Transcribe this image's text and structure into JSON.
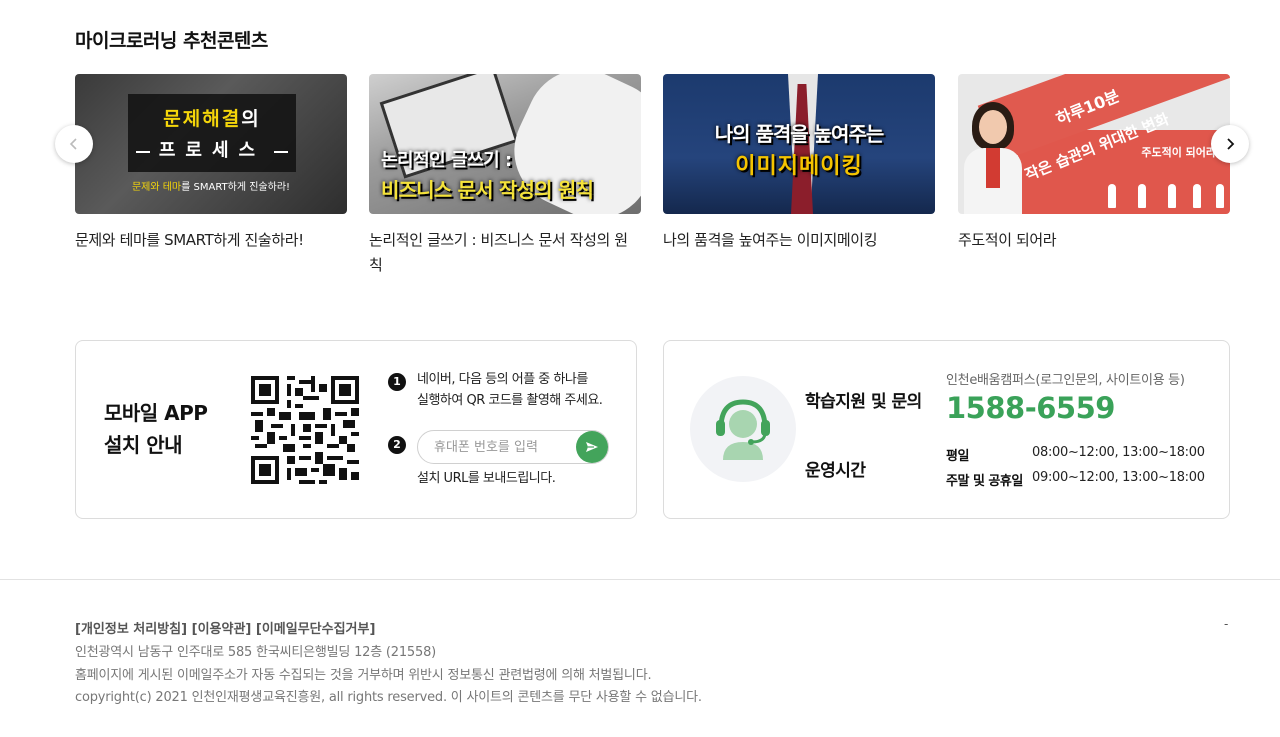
{
  "section": {
    "title": "마이크로러닝 추천콘텐츠"
  },
  "cards": [
    {
      "caption": "문제와 테마를 SMART하게 진술하라!",
      "thumb": {
        "line1_a": "문제",
        "line1_b": "해결",
        "line1_c": "의",
        "line2": "프로세스",
        "sub_a": "문제와 테마",
        "sub_b": "를 SMART하게 진술하라!"
      }
    },
    {
      "caption": "논리적인 글쓰기 : 비즈니스 문서 작성의 원칙",
      "thumb": {
        "line1": "논리적인 글쓰기 :",
        "line2": "비즈니스 문서 작성의 원칙"
      }
    },
    {
      "caption": "나의 품격을 높여주는 이미지메이킹",
      "thumb": {
        "line1": "나의 품격을 높여주는",
        "line2": "이미지메이킹"
      }
    },
    {
      "caption": "주도적이 되어라",
      "thumb": {
        "line1": "하루10분",
        "line2": "작은 습관의 위대한 변화",
        "tag": "주도적이 되어라"
      }
    }
  ],
  "app": {
    "title_line1": "모바일 APP",
    "title_line2": "설치 안내",
    "step1_num": "1",
    "step1_line1": "네이버, 다음 등의 어플 중 하나를",
    "step1_line2": "실행하여 QR 코드를 촬영해 주세요.",
    "step2_num": "2",
    "phone_placeholder": "휴대폰 번호를 입력",
    "step2_text": "설치 URL를 보내드립니다."
  },
  "support": {
    "heading": "학습지원 및 문의",
    "hours_label": "운영시간",
    "sub": "인천e배움캠퍼스(로그인문의, 사이트이용 등)",
    "phone": "1588-6559",
    "weekday_label": "평일",
    "weekday_hours": "08:00~12:00, 13:00~18:00",
    "weekend_label": "주말 및 공휴일",
    "weekend_hours": "09:00~12:00, 13:00~18:00"
  },
  "footer": {
    "link_privacy": "[개인정보 처리방침]",
    "link_terms": "[이용약관]",
    "link_email": "[이메일무단수집거부]",
    "address": "인천광역시 남동구 인주대로 585 한국씨티은행빌딩 12층 (21558)",
    "notice": "홈페이지에 게시된 이메일주소가 자동 수집되는 것을 거부하며 위반시 정보통신 관련법령에 의해 처벌됩니다.",
    "copyright": "copyright(c) 2021 인천인재평생교육진흥원, all rights reserved. 이 사이트의 콘텐츠를 무단 사용할 수 없습니다.",
    "dash": "-"
  },
  "colors": {
    "accent_green": "#3aa259",
    "send_green": "#43a45b",
    "title_yellow": "#f5d60a"
  },
  "icons": {
    "prev": "chevron-left-icon",
    "next": "chevron-right-icon",
    "send": "send-arrow-icon",
    "support": "headset-agent-icon"
  }
}
